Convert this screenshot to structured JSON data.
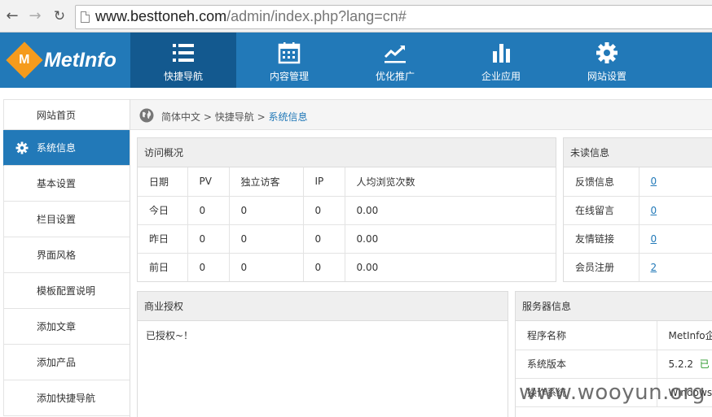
{
  "browser": {
    "url_host": "www.besttoneh.com",
    "url_path": "/admin/index.php?lang=cn#"
  },
  "header": {
    "logo_text": "MetInfo",
    "logo_mark": "M",
    "nav": [
      {
        "label": "快捷导航",
        "icon": "list-icon",
        "active": true
      },
      {
        "label": "内容管理",
        "icon": "calendar-icon",
        "active": false
      },
      {
        "label": "优化推广",
        "icon": "trend-chart-icon",
        "active": false
      },
      {
        "label": "企业应用",
        "icon": "bar-chart-icon",
        "active": false
      },
      {
        "label": "网站设置",
        "icon": "gear-icon",
        "active": false
      }
    ]
  },
  "sidebar": {
    "items": [
      {
        "label": "网站首页"
      },
      {
        "label": "系统信息",
        "active": true
      },
      {
        "label": "基本设置"
      },
      {
        "label": "栏目设置"
      },
      {
        "label": "界面风格"
      },
      {
        "label": "模板配置说明"
      },
      {
        "label": "添加文章"
      },
      {
        "label": "添加产品"
      },
      {
        "label": "添加快捷导航"
      }
    ]
  },
  "breadcrumb": {
    "lang": "简体中文",
    "sep1": ">",
    "section": "快捷导航",
    "sep2": ">",
    "current": "系统信息"
  },
  "visits": {
    "title": "访问概况",
    "headers": [
      "日期",
      "PV",
      "独立访客",
      "IP",
      "人均浏览次数"
    ],
    "rows": [
      [
        "今日",
        "0",
        "0",
        "0",
        "0.00"
      ],
      [
        "昨日",
        "0",
        "0",
        "0",
        "0.00"
      ],
      [
        "前日",
        "0",
        "0",
        "0",
        "0.00"
      ]
    ]
  },
  "unread": {
    "title": "未读信息",
    "rows": [
      {
        "label": "反馈信息",
        "value": "0"
      },
      {
        "label": "在线留言",
        "value": "0"
      },
      {
        "label": "友情链接",
        "value": "0"
      },
      {
        "label": "会员注册",
        "value": "2"
      }
    ]
  },
  "license": {
    "title": "商业授权",
    "text": "已授权~！"
  },
  "server": {
    "title": "服务器信息",
    "rows": [
      {
        "label": "程序名称",
        "value": "MetInfo企",
        "extra": ""
      },
      {
        "label": "系统版本",
        "value": "5.2.2",
        "extra": "已"
      },
      {
        "label": "操作系统",
        "value": "Windows",
        "extra": ""
      }
    ]
  },
  "watermark": "www.wooyun.org",
  "colors": {
    "brand_blue": "#2279b8",
    "active_nav": "#13598f",
    "logo_orange": "#f59b1d",
    "link": "#2279b8"
  }
}
